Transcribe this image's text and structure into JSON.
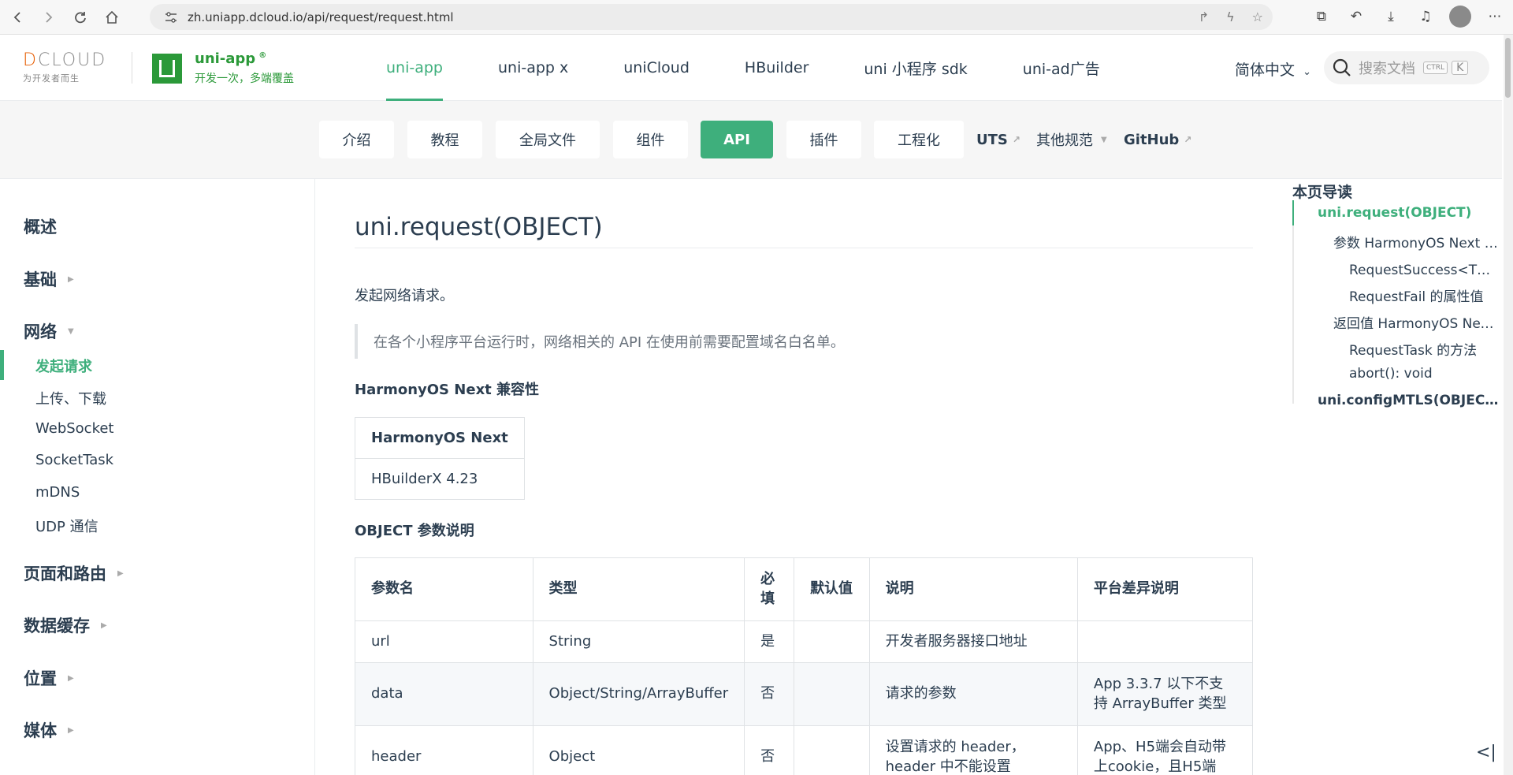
{
  "browser": {
    "url": "zh.uniapp.dcloud.io/api/request/request.html"
  },
  "header": {
    "dcloud_word_a": "D",
    "dcloud_word_b": "CLOUD",
    "dcloud_sub": "为开发者而生",
    "brand_title": "uni-app",
    "brand_mark": "®",
    "brand_sub": "开发一次，多端覆盖",
    "nav": [
      {
        "label": "uni-app"
      },
      {
        "label": "uni-app x"
      },
      {
        "label": "uniCloud"
      },
      {
        "label": "HBuilder"
      },
      {
        "label": "uni 小程序 sdk"
      },
      {
        "label": "uni-ad广告"
      }
    ],
    "language": "简体中文",
    "search_placeholder": "搜索文档",
    "kbd_ctrl": "CTRL",
    "kbd_k": "K"
  },
  "subnav": {
    "tabs": [
      {
        "label": "介绍"
      },
      {
        "label": "教程"
      },
      {
        "label": "全局文件"
      },
      {
        "label": "组件"
      },
      {
        "label": "API"
      },
      {
        "label": "插件"
      },
      {
        "label": "工程化"
      }
    ],
    "uts": "UTS",
    "other": "其他规范",
    "github": "GitHub"
  },
  "sidebar": {
    "groups": [
      {
        "label": "概述"
      },
      {
        "label": "基础"
      },
      {
        "label": "网络"
      },
      {
        "label": "页面和路由"
      },
      {
        "label": "数据缓存"
      },
      {
        "label": "位置"
      },
      {
        "label": "媒体"
      }
    ],
    "network_items": [
      {
        "label": "发起请求"
      },
      {
        "label": "上传、下载"
      },
      {
        "label": "WebSocket"
      },
      {
        "label": "SocketTask"
      },
      {
        "label": "mDNS"
      },
      {
        "label": "UDP 通信"
      }
    ]
  },
  "main": {
    "title": "uni.request(OBJECT)",
    "description": "发起网络请求。",
    "note": "在各个小程序平台运行时，网络相关的 API 在使用前需要配置域名白名单。",
    "compat_heading": "HarmonyOS Next 兼容性",
    "compat_header": "HarmonyOS Next",
    "compat_value": "HBuilderX 4.23",
    "params_heading": "OBJECT 参数说明",
    "params_columns": [
      "参数名",
      "类型",
      "必填",
      "默认值",
      "说明",
      "平台差异说明"
    ],
    "params_rows": [
      [
        "url",
        "String",
        "是",
        "",
        "开发者服务器接口地址",
        ""
      ],
      [
        "data",
        "Object/String/ArrayBuffer",
        "否",
        "",
        "请求的参数",
        "App 3.3.7 以下不支持 ArrayBuffer 类型"
      ],
      [
        "header",
        "Object",
        "否",
        "",
        "设置请求的 header，header 中不能设置",
        "App、H5端会自动带上cookie，且H5端"
      ]
    ]
  },
  "toc": {
    "title": "本页导读",
    "items": [
      {
        "label": "uni.request(OBJECT)"
      },
      {
        "label": "参数 HarmonyOS Next 兼..."
      },
      {
        "label": "RequestSuccess<T> 的..."
      },
      {
        "label": "RequestFail 的属性值"
      },
      {
        "label": "返回值 HarmonyOS Next ..."
      },
      {
        "label": "RequestTask 的方法"
      },
      {
        "label": "abort(): void"
      },
      {
        "label": "uni.configMTLS(OBJECT)"
      }
    ]
  },
  "colors": {
    "accent": "#3eaf7c",
    "brand": "#2b9939"
  }
}
